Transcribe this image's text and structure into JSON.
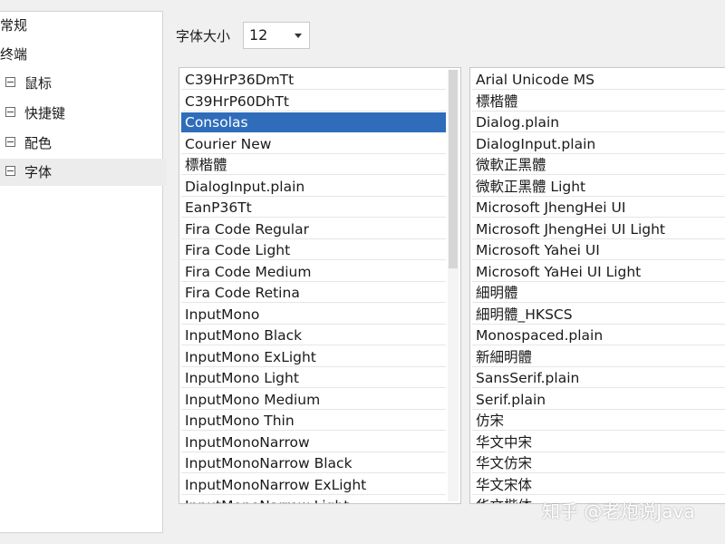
{
  "nav": {
    "items": [
      {
        "label": "常规",
        "indent": 0,
        "expander": false
      },
      {
        "label": "终端",
        "indent": 0,
        "expander": false
      },
      {
        "label": "鼠标",
        "indent": 1,
        "expander": true
      },
      {
        "label": "快捷键",
        "indent": 1,
        "expander": true
      },
      {
        "label": "配色",
        "indent": 1,
        "expander": true
      },
      {
        "label": "字体",
        "indent": 1,
        "expander": true,
        "selected": true
      }
    ]
  },
  "font_size": {
    "label": "字体大小",
    "value": "12"
  },
  "fonts_left": {
    "items": [
      "C39HrP36DmTt",
      "C39HrP60DhTt",
      "Consolas",
      "Courier New",
      "標楷體",
      "DialogInput.plain",
      "EanP36Tt",
      "Fira Code Regular",
      "Fira Code Light",
      "Fira Code Medium",
      "Fira Code Retina",
      "InputMono",
      "InputMono Black",
      "InputMono ExLight",
      "InputMono Light",
      "InputMono Medium",
      "InputMono Thin",
      "InputMonoNarrow",
      "InputMonoNarrow Black",
      "InputMonoNarrow ExLight",
      "InputMonoNarrow Light"
    ],
    "selected_index": 2,
    "scroll_position": 0.0,
    "scroll_visible_fraction": 0.46
  },
  "fonts_right": {
    "items": [
      "Arial Unicode MS",
      "標楷體",
      "Dialog.plain",
      "DialogInput.plain",
      "微軟正黑體",
      "微軟正黑體 Light",
      "Microsoft JhengHei UI",
      "Microsoft JhengHei UI Light",
      "Microsoft Yahei UI",
      "Microsoft YaHei UI Light",
      "細明體",
      "細明體_HKSCS",
      "Monospaced.plain",
      "新細明體",
      "SansSerif.plain",
      "Serif.plain",
      "仿宋",
      "华文中宋",
      "华文仿宋",
      "华文宋体",
      "华文楷体"
    ]
  },
  "watermark": {
    "text": "知乎 @老炮说Java",
    "logo_icon": "zhihu-logo"
  },
  "colors": {
    "selection": "#2f6dbb",
    "panel": "#ffffff",
    "background": "#f0f0f0"
  }
}
